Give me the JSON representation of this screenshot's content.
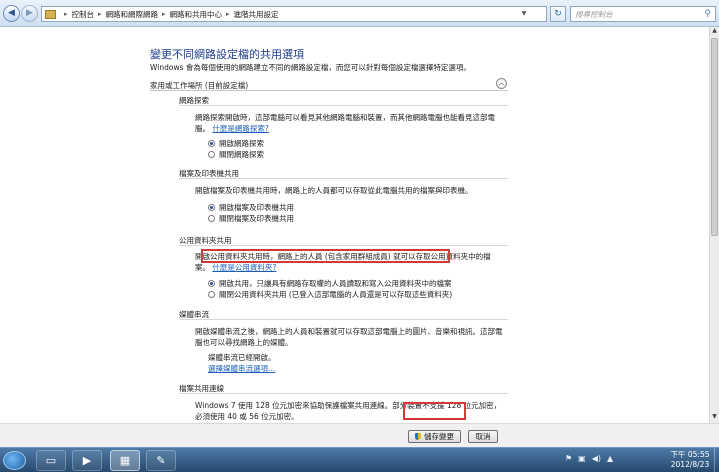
{
  "address_bar": {
    "crumbs": [
      "控制台",
      "網路和網際網路",
      "網路和共用中心",
      "進階共用設定"
    ],
    "search_placeholder": "搜尋控制台"
  },
  "page": {
    "title": "變更不同網路設定檔的共用選項",
    "description": "Windows 會為每個使用的網路建立不同的網路設定檔，而您可以針對每個設定檔選擇特定選項。",
    "profile_label": "家用或工作場所 (目前設定檔)"
  },
  "sections": {
    "network_discovery": {
      "heading": "網路探索",
      "text": "網路探索開啟時，這部電腦可以看見其他網路電腦和裝置，而其他網路電腦也能看見這部電腦。",
      "link": "什麼是網路探索?",
      "options": [
        "開啟網路探索",
        "關閉網路探索"
      ]
    },
    "file_printer": {
      "heading": "檔案及印表機共用",
      "text": "開啟檔案及印表機共用時，網路上的人員都可以存取從此電腦共用的檔案與印表機。",
      "options": [
        "開啟檔案及印表機共用",
        "關閉檔案及印表機共用"
      ]
    },
    "public_folder": {
      "heading": "公用資料夾共用",
      "text": "開啟公用資料夾共用時，網路上的人員 (包含家用群組成員) 就可以存取公用資料夾中的檔案。",
      "link": "什麼是公用資料夾?",
      "options": [
        "開啟共用，只讓具有網路存取權的人員讀取和寫入公用資料夾中的檔案",
        "關閉公用資料夾共用 (已登入這部電腦的人員還是可以存取這些資料夾)"
      ]
    },
    "media_streaming": {
      "heading": "媒體串流",
      "text": "開啟媒體串流之後，網路上的人員和裝置就可以存取這部電腦上的圖片、音樂和視訊。這部電腦也可以尋找網路上的媒體。",
      "status": "媒體串流已經開啟。",
      "link": "選擇媒體串流選項..."
    },
    "file_sharing": {
      "heading": "檔案共用連線",
      "text": "Windows 7 使用 128 位元加密來協助保護檔案共用連線。部分裝置不支援 128 位元加密，必須使用 40 或 56 位元加密。"
    }
  },
  "buttons": {
    "save": "儲存變更",
    "cancel": "取消"
  },
  "taskbar": {
    "time": "下午 05:55",
    "date": "2012/8/23"
  }
}
